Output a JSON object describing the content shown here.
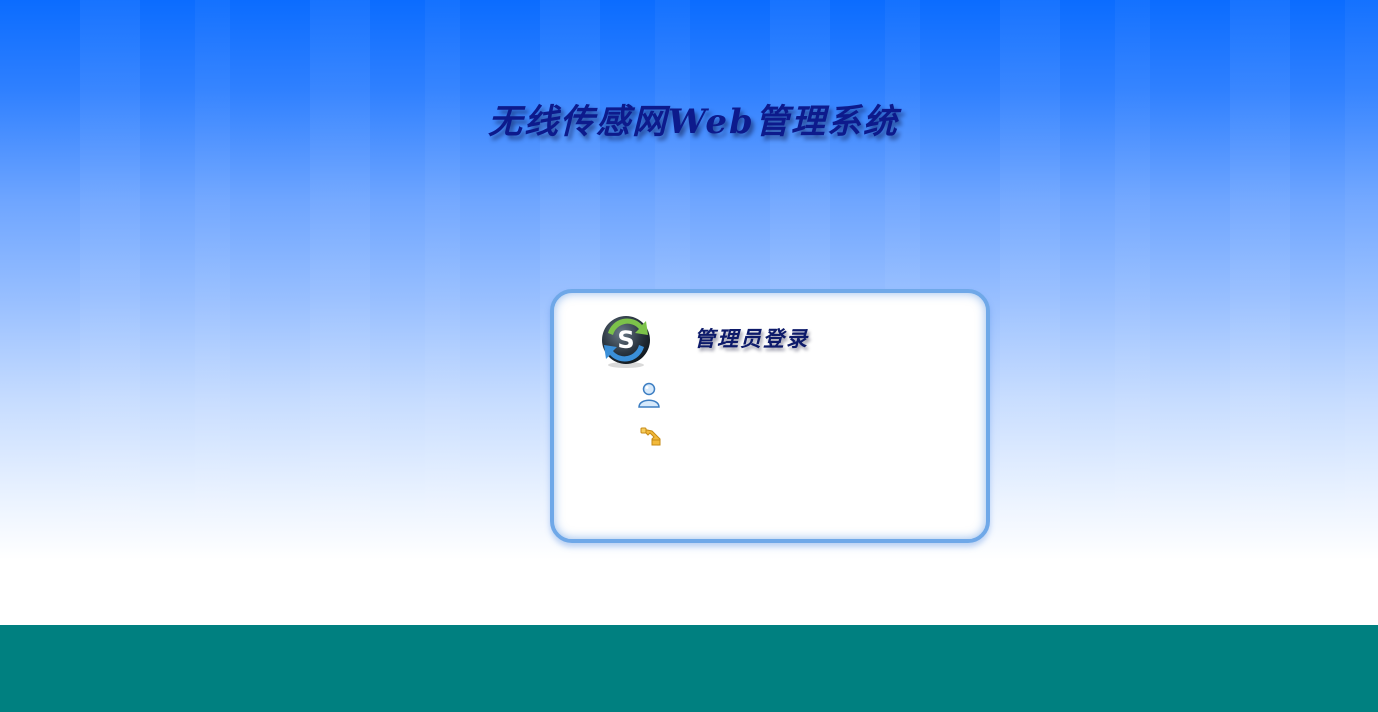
{
  "header": {
    "title": "无线传感网Web管理系统"
  },
  "login": {
    "title": "管理员登录",
    "logo_icon": "refresh-s-logo-icon",
    "user_icon": "user-icon",
    "password_icon": "key-icon"
  },
  "colors": {
    "title": "#0d1a8c",
    "panel_border": "#6fa8e8",
    "footer": "#008080",
    "sky_top": "#0b6cff"
  }
}
